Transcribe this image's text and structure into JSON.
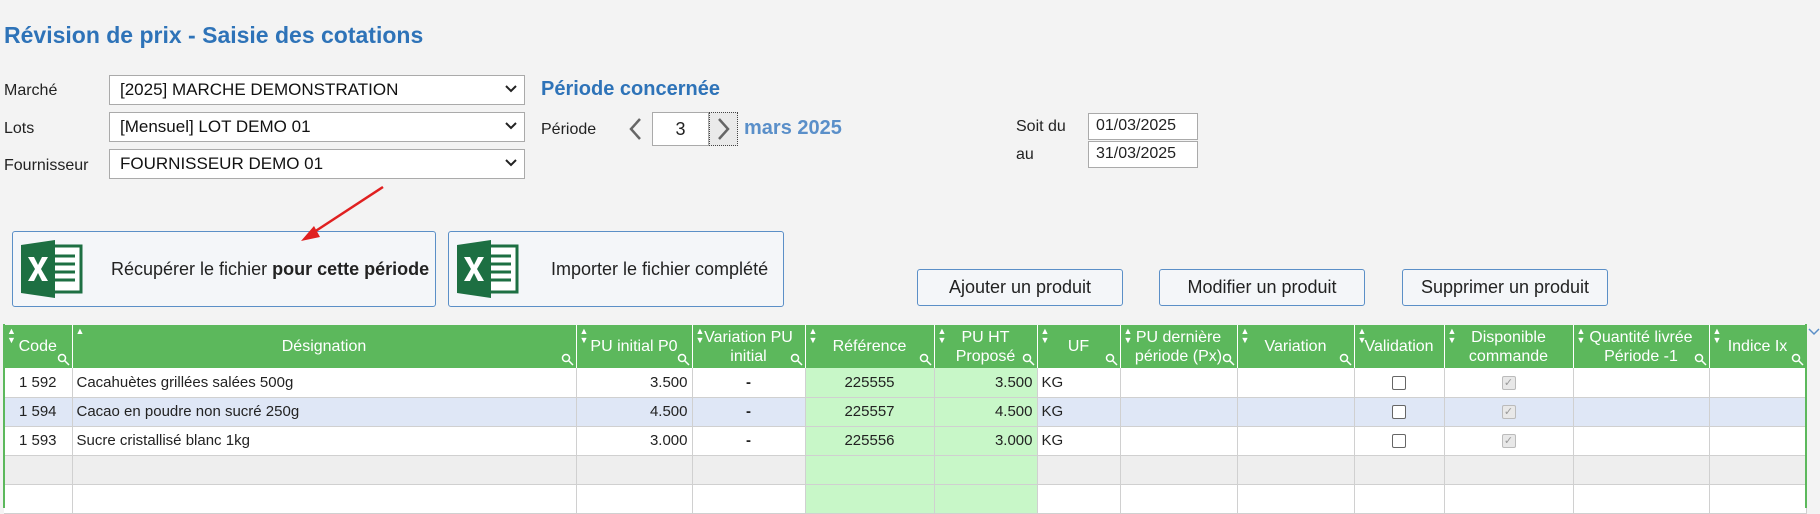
{
  "title": "Révision de prix - Saisie des cotations",
  "form": {
    "marche_label": "Marché",
    "marche_value": "[2025] MARCHE DEMONSTRATION",
    "lots_label": "Lots",
    "lots_value": "[Mensuel] LOT DEMO 01",
    "fournisseur_label": "Fournisseur",
    "fournisseur_value": "FOURNISSEUR DEMO 01"
  },
  "period": {
    "section_title": "Période concernée",
    "label": "Période",
    "value": "3",
    "month": "mars 2025",
    "soit_du_label": "Soit du",
    "start_date": "01/03/2025",
    "au_label": "au",
    "end_date": "31/03/2025"
  },
  "actions": {
    "download_prefix": "Récupérer le fichier ",
    "download_bold": "pour cette période",
    "import": "Importer le fichier complété",
    "add": "Ajouter un produit",
    "modify": "Modifier un produit",
    "delete": "Supprimer un produit"
  },
  "table": {
    "headers": [
      "Code",
      "Désignation",
      "PU initial P0",
      "Variation PU initial",
      "Référence",
      "PU HT Proposé",
      "UF",
      "PU dernière période (Px)",
      "Variation",
      "Validation",
      "Disponible commande",
      "Quantité livrée Période -1",
      "Indice Ix"
    ],
    "rows": [
      {
        "code": "1 592",
        "designation": "Cacahuètes grillées salées 500g",
        "pu_initial": "3.500",
        "variation_pu": "-",
        "reference": "225555",
        "pu_ht": "3.500",
        "uf": "KG"
      },
      {
        "code": "1 594",
        "designation": "Cacao en poudre non sucré 250g",
        "pu_initial": "4.500",
        "variation_pu": "-",
        "reference": "225557",
        "pu_ht": "4.500",
        "uf": "KG"
      },
      {
        "code": "1 593",
        "designation": "Sucre cristallisé blanc 1kg",
        "pu_initial": "3.000",
        "variation_pu": "-",
        "reference": "225556",
        "pu_ht": "3.000",
        "uf": "KG"
      }
    ]
  },
  "colors": {
    "accent": "#2e73b8",
    "header_green": "#5cb85c",
    "cell_green": "#c8f7c8",
    "alt_row": "#dfe7f6"
  }
}
